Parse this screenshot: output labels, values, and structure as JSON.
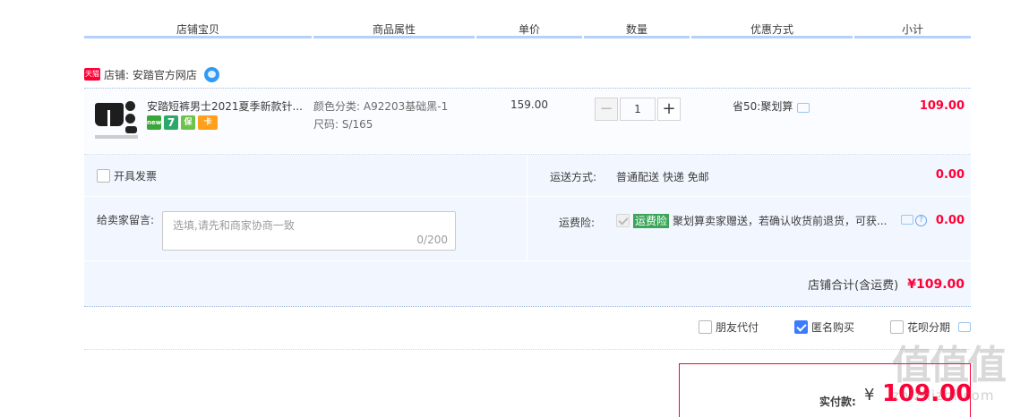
{
  "header": {
    "cols": [
      "店铺宝贝",
      "商品属性",
      "单价",
      "数量",
      "优惠方式",
      "小计"
    ]
  },
  "shop": {
    "badge": "天猫",
    "label": "店铺: 安踏官方网店"
  },
  "item": {
    "title": "安踏短裤男士2021夏季新款针...",
    "badges": [
      "new",
      "7",
      "保",
      "卡"
    ],
    "attr_color": "颜色分类: A92203基础黑-1",
    "attr_size": "尺码: S/165",
    "price": "159.00",
    "quantity": "1",
    "minus": "−",
    "plus": "+",
    "promo": "省50:聚划算",
    "subtotal": "109.00"
  },
  "invoice": {
    "label": "开具发票"
  },
  "shipping": {
    "label": "运送方式:",
    "value": "普通配送 快递 免邮",
    "fee": "0.00"
  },
  "memo": {
    "label": "给卖家留言:",
    "placeholder": "选填,请先和商家协商一致",
    "count": "0/200"
  },
  "insurance": {
    "label": "运费险:",
    "tag": "运费险",
    "text": "聚划算卖家赠送，若确认收货前退货，可获...",
    "help": "?",
    "fee": "0.00"
  },
  "shop_total": {
    "label": "店铺合计(含运费)",
    "value": "¥109.00"
  },
  "options": {
    "friend_pay": "朋友代付",
    "anonymous": "匿名购买",
    "huabei": "花呗分期"
  },
  "pay": {
    "label": "实付款:",
    "currency": "¥",
    "amount": "109.00"
  },
  "watermark": {
    "big": "值值值",
    "small": "zhizhizhi.com"
  },
  "colors": {
    "accent_red": "#ff0036",
    "header_border": "#b2d1ff",
    "panel_bg": "#f2f7ff",
    "check_blue": "#3b7cff",
    "insurance_green": "#3ba55a"
  }
}
